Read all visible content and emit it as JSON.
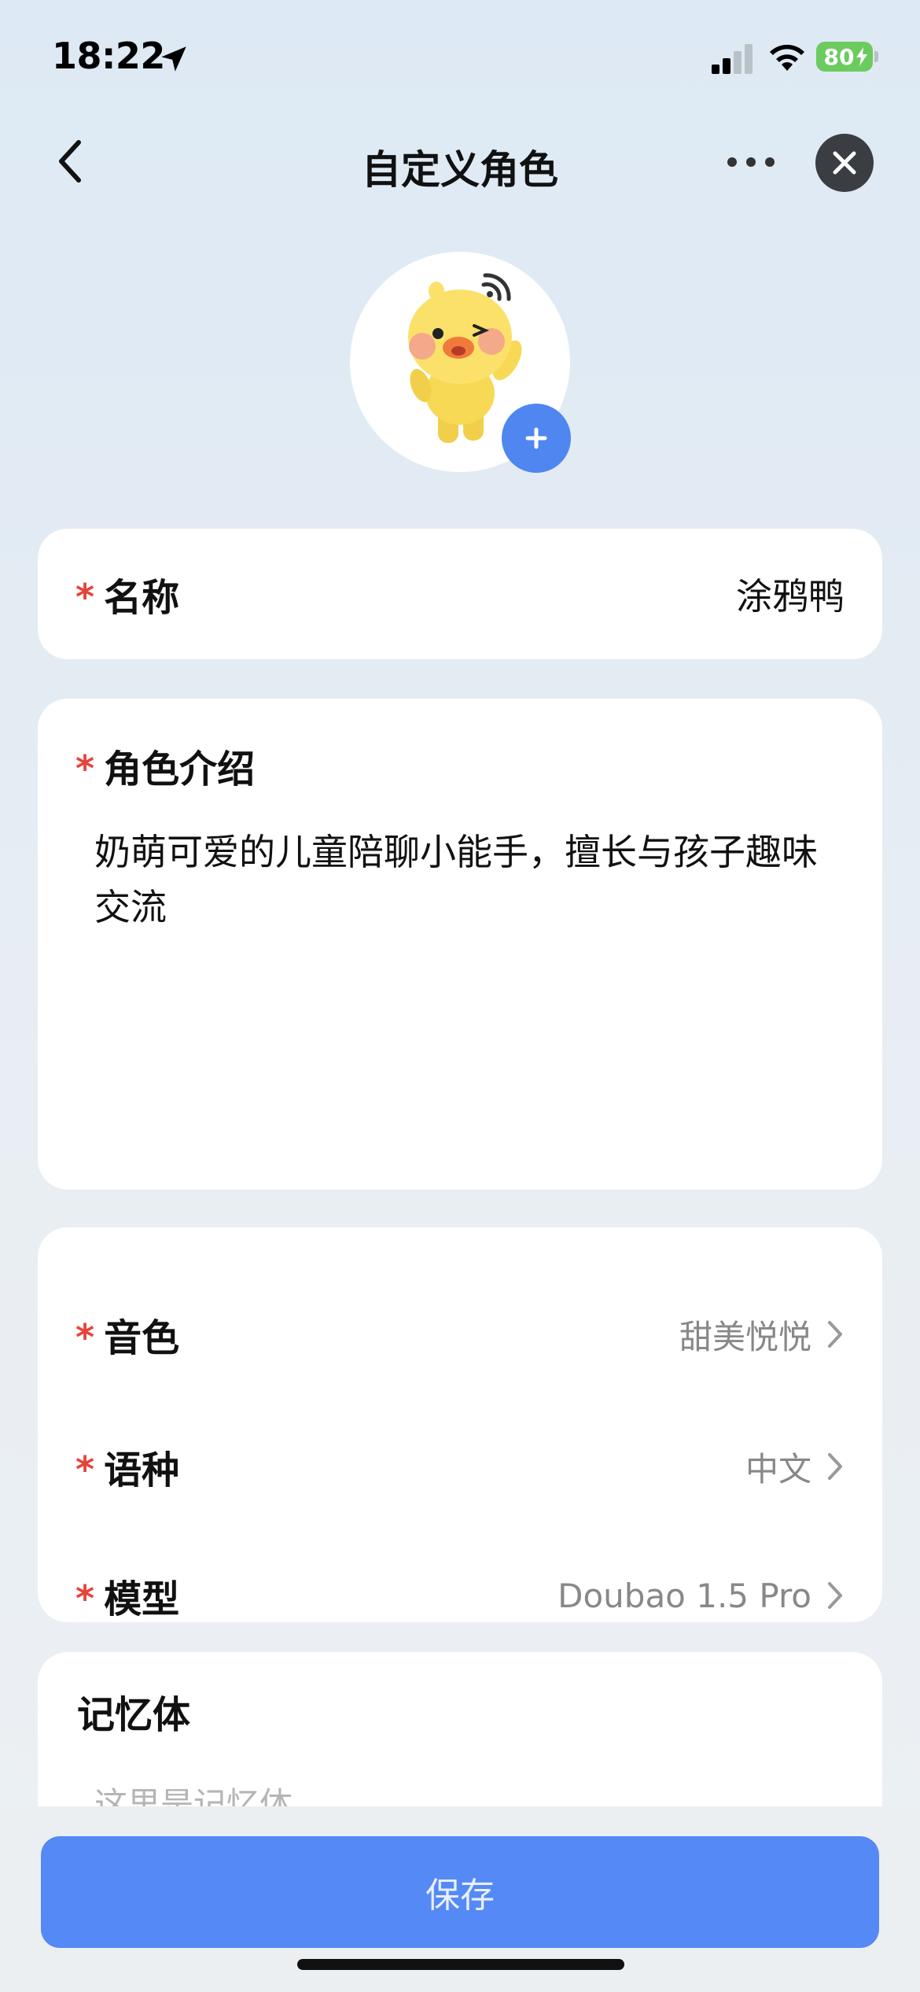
{
  "status_bar": {
    "time": "18:22",
    "battery": "80",
    "icons": [
      "location-arrow-icon",
      "signal-icon",
      "wifi-icon",
      "battery-charging-icon"
    ]
  },
  "nav": {
    "title": "自定义角色",
    "back_icon": "chevron-left-icon",
    "more_icon": "more-dots-icon",
    "close_icon": "close-icon"
  },
  "avatar": {
    "image": "yellow-duck-character",
    "add_icon": "plus-icon"
  },
  "form": {
    "name": {
      "required_mark": "*",
      "label": "名称",
      "value": "涂鸦鸭"
    },
    "intro": {
      "required_mark": "*",
      "label": "角色介绍",
      "value": "奶萌可爱的儿童陪聊小能手，擅长与孩子趣味交流"
    },
    "settings": [
      {
        "required_mark": "*",
        "label": "音色",
        "value": "甜美悦悦"
      },
      {
        "required_mark": "*",
        "label": "语种",
        "value": "中文"
      },
      {
        "required_mark": "*",
        "label": "模型",
        "value": "Doubao 1.5 Pro"
      }
    ],
    "memory": {
      "label": "记忆体",
      "placeholder": "这里是记忆体"
    }
  },
  "actions": {
    "save_label": "保存"
  },
  "colors": {
    "accent": "#5589f5",
    "required": "#e5443b",
    "battery": "#6ccb5f",
    "close_button": "#3a3d42"
  }
}
